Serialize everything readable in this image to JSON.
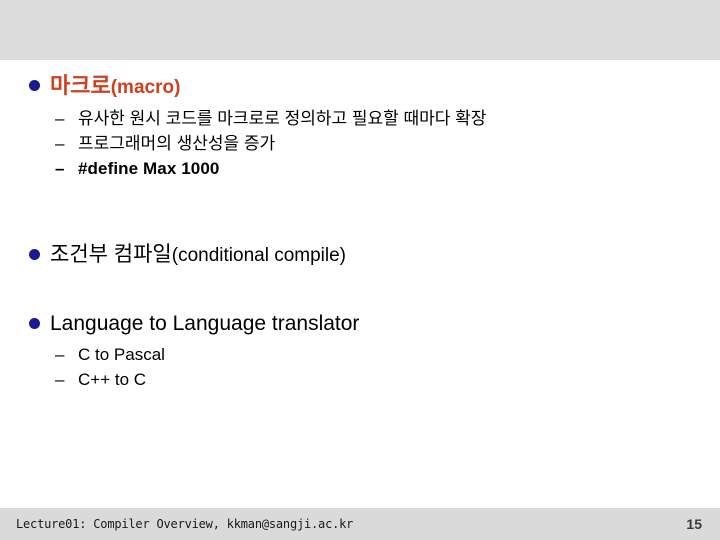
{
  "slide": {
    "page_number": "15",
    "footer": "Lecture01: Compiler Overview, kkman@sangji.ac.kr",
    "colors": {
      "band": "#dcdcdc",
      "bullet_dot": "#1b1b8f",
      "accent_heading": "#cf401f",
      "body_text": "#000000",
      "page_number": "#3a3a3a"
    },
    "blocks": [
      {
        "id": "macro",
        "heading_main": "마크로",
        "heading_paren": "(macro)",
        "accent": true,
        "sub_items": [
          {
            "dash": "–",
            "text": "유사한 원시 코드를 마크로로 정의하고 필요할 때마다 확장",
            "code": false
          },
          {
            "dash": "–",
            "text": "프로그래머의 생산성을 증가",
            "code": false
          },
          {
            "dash": "–",
            "text": "#define Max 1000",
            "code": true
          }
        ]
      },
      {
        "id": "conditional-compile",
        "heading_main": "조건부 컴파일",
        "heading_paren": "(conditional compile)",
        "accent": false,
        "sub_items": []
      },
      {
        "id": "language-translator",
        "heading_main": "Language to Language translator",
        "heading_paren": "",
        "accent": false,
        "sub_items": [
          {
            "dash": "–",
            "text": "C to Pascal",
            "code": false
          },
          {
            "dash": "–",
            "text": "C++ to C",
            "code": false
          }
        ]
      }
    ]
  }
}
